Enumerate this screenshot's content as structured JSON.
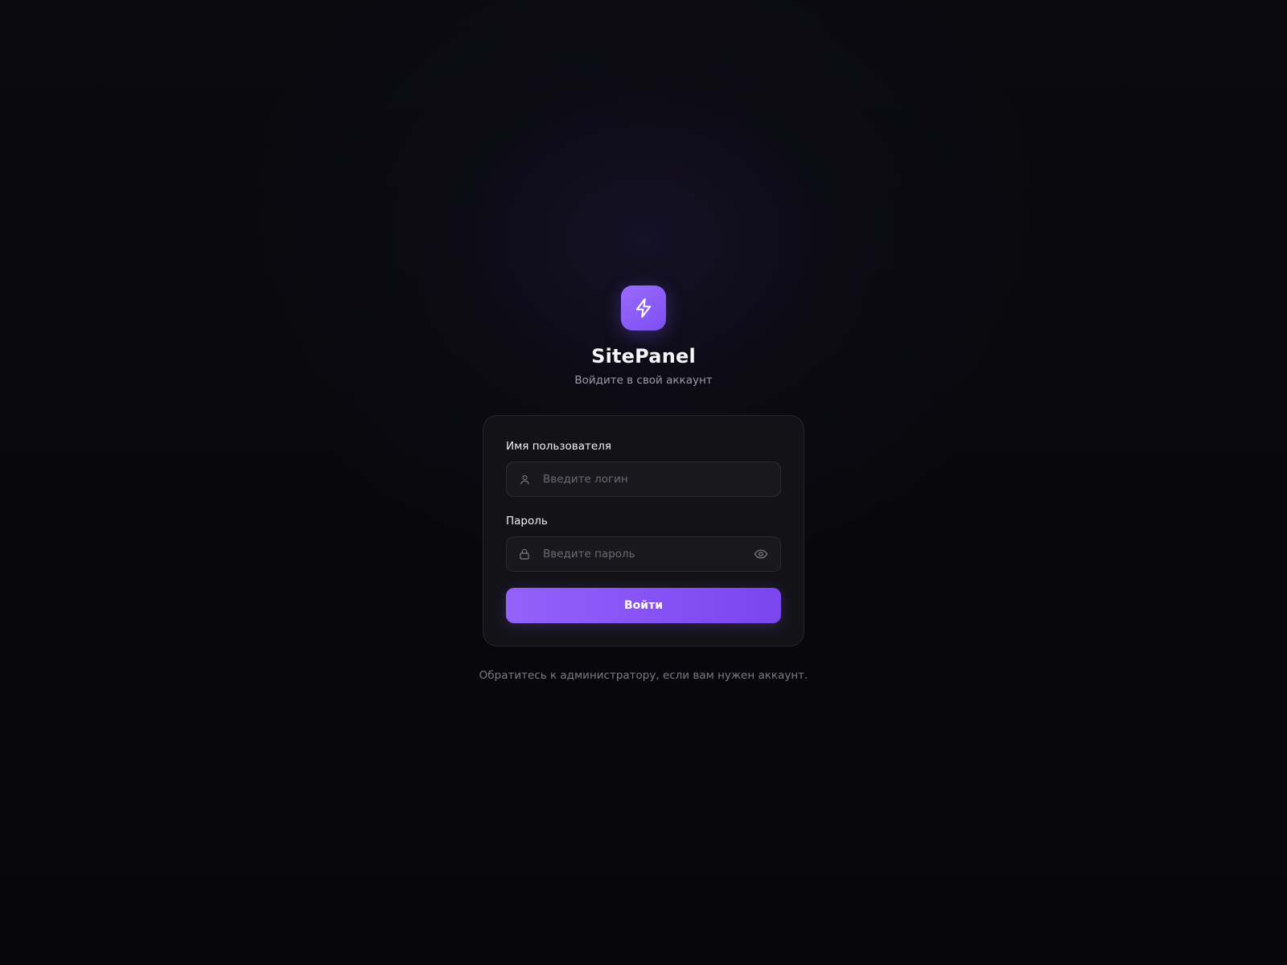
{
  "brand": {
    "name": "SitePanel",
    "subtitle": "Войдите в свой аккаунт",
    "logo_icon": "lightning-bolt-icon",
    "accent_color": "#8b5cf6"
  },
  "form": {
    "username": {
      "label": "Имя пользователя",
      "placeholder": "Введите логин",
      "value": "",
      "icon": "user-icon"
    },
    "password": {
      "label": "Пароль",
      "placeholder": "Введите пароль",
      "value": "",
      "icon": "lock-icon",
      "toggle_icon": "eye-icon"
    },
    "submit_label": "Войти"
  },
  "footer": {
    "note": "Обратитесь к администратору, если вам нужен аккаунт."
  }
}
